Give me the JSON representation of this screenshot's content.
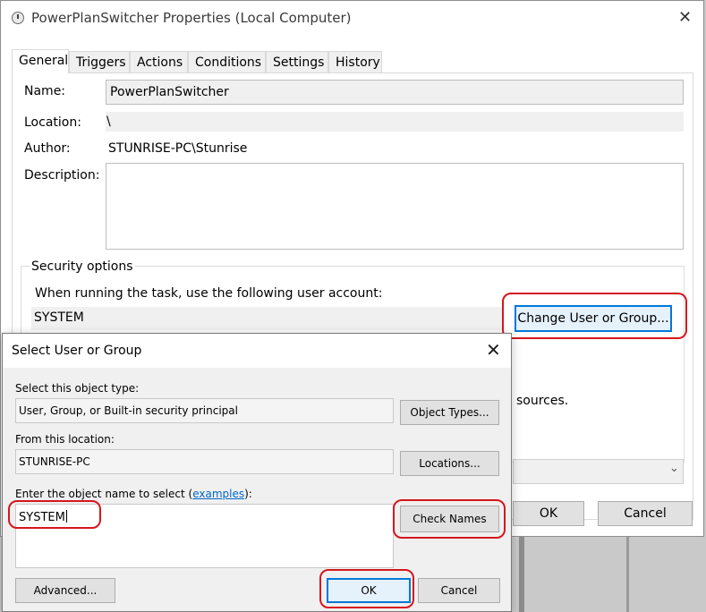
{
  "properties_window": {
    "title": "PowerPlanSwitcher Properties (Local Computer)",
    "close_glyph": "✕",
    "tabs": [
      {
        "label": "General"
      },
      {
        "label": "Triggers"
      },
      {
        "label": "Actions"
      },
      {
        "label": "Conditions"
      },
      {
        "label": "Settings"
      },
      {
        "label": "History"
      }
    ],
    "active_tab": "General",
    "name_label": "Name:",
    "name_value": "PowerPlanSwitcher",
    "location_label": "Location:",
    "location_value": "\\",
    "author_label": "Author:",
    "author_value": "STUNRISE-PC\\Stunrise",
    "description_label": "Description:",
    "description_value": "",
    "security": {
      "group_label": "Security options",
      "run_as_text": "When running the task, use the following user account:",
      "account": "SYSTEM",
      "change_button": "Change User or Group...",
      "partial_text": "sources."
    },
    "ok_button": "OK",
    "cancel_button": "Cancel",
    "dropdown_glyph": "⌄"
  },
  "select_dialog": {
    "title": "Select User or Group",
    "close_glyph": "✕",
    "object_type_label": "Select this object type:",
    "object_type_value": "User, Group, or Built-in security principal",
    "object_types_button": "Object Types...",
    "location_label": "From this location:",
    "location_value": "STUNRISE-PC",
    "locations_button": "Locations...",
    "enter_name_label_prefix": "Enter the object name to select (",
    "enter_name_link": "examples",
    "enter_name_label_suffix": "):",
    "object_name_value": "SYSTEM",
    "check_names_button": "Check Names",
    "advanced_button": "Advanced...",
    "ok_button": "OK",
    "cancel_button": "Cancel"
  },
  "colors": {
    "highlight": "#d6161e",
    "focus_blue": "#0078d7",
    "link": "#0066cc"
  }
}
